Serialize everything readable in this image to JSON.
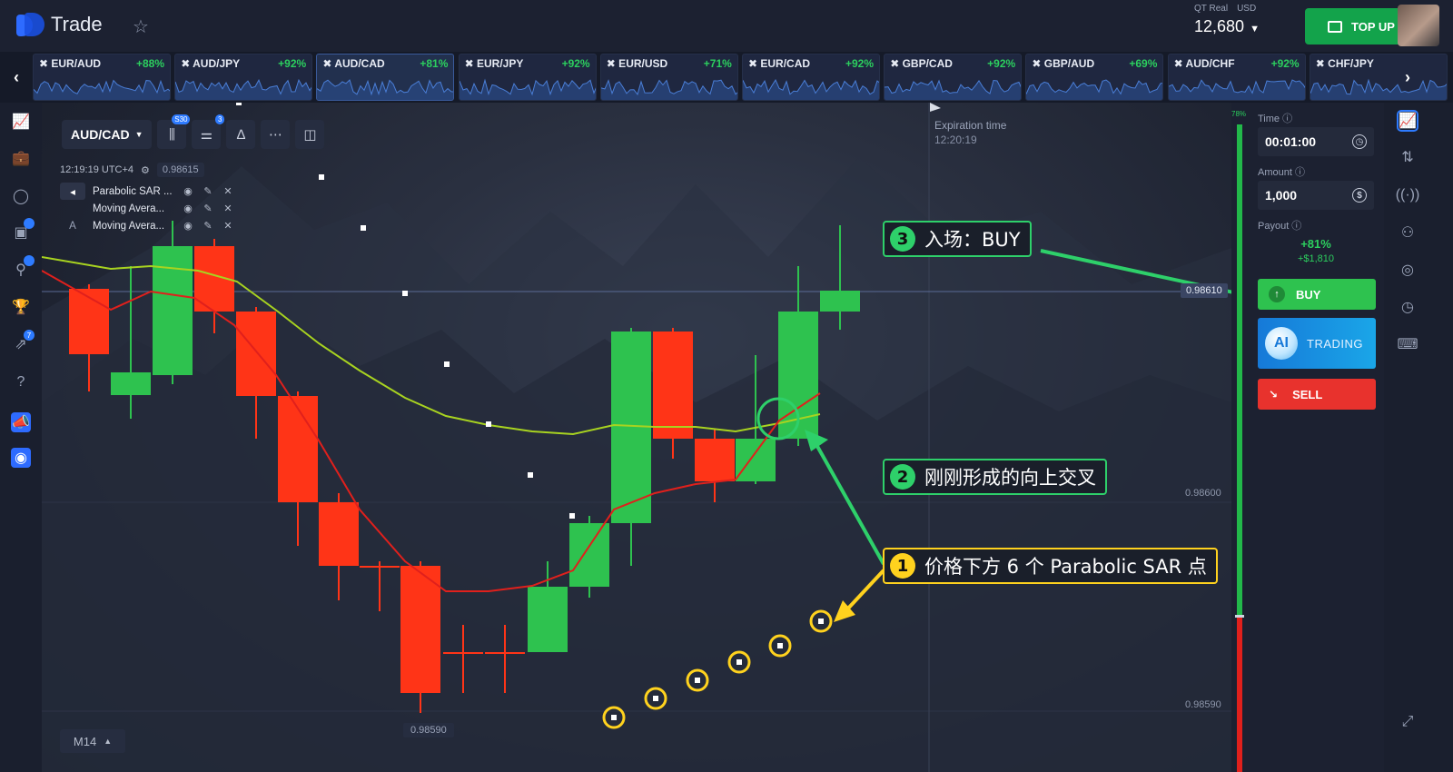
{
  "app": {
    "name": "Trade"
  },
  "account": {
    "type": "QT Real",
    "currency": "USD",
    "balance": "12,680"
  },
  "topup_label": "TOP UP",
  "assets": [
    {
      "name": "EUR/AUD",
      "pct": "+88%"
    },
    {
      "name": "AUD/JPY",
      "pct": "+92%"
    },
    {
      "name": "AUD/CAD",
      "pct": "+81%"
    },
    {
      "name": "EUR/JPY",
      "pct": "+92%"
    },
    {
      "name": "EUR/USD",
      "pct": "+71%"
    },
    {
      "name": "EUR/CAD",
      "pct": "+92%"
    },
    {
      "name": "GBP/CAD",
      "pct": "+92%"
    },
    {
      "name": "GBP/AUD",
      "pct": "+69%"
    },
    {
      "name": "AUD/CHF",
      "pct": "+92%"
    },
    {
      "name": "CHF/JPY",
      "pct": ""
    }
  ],
  "leftnav_badges": {
    "rocket": "",
    "share": "7"
  },
  "chart": {
    "pair": "AUD/CAD",
    "badge_candles": "S30",
    "badge_indicators": "3",
    "time": "12:19:19 UTC+4",
    "current_value": "0.98615",
    "indicators": [
      "Parabolic SAR ...",
      "Moving Avera...",
      "Moving Avera..."
    ],
    "expiration_label": "Expiration time",
    "expiration_time": "12:20:19",
    "price_tag": "0.98610",
    "y_labels": [
      "0.98600",
      "0.98590"
    ],
    "x_label": "0.98590",
    "timeframe": "M14"
  },
  "annotations": {
    "c1": {
      "num": "1",
      "text": "价格下方 6 个 Parabolic SAR 点"
    },
    "c2": {
      "num": "2",
      "text": "刚刚形成的向上交叉"
    },
    "c3": {
      "num": "3",
      "text": "入场：BUY"
    }
  },
  "trade_panel": {
    "meter_pct": "78%",
    "time_label": "Time",
    "time_value": "00:01:00",
    "amount_label": "Amount",
    "amount_value": "1,000",
    "payout_label": "Payout",
    "payout_pct": "+81%",
    "payout_amount": "+$1,810",
    "buy_label": "BUY",
    "ai_badge": "AI",
    "ai_label": "TRADING",
    "sell_label": "SELL"
  },
  "colors": {
    "bull": "#2ec24f",
    "bear": "#ff3417",
    "ma_fast": "#e0201c",
    "ma_slow": "#a8d320",
    "callout_green": "#2ed06a",
    "callout_yellow": "#ffd21e"
  }
}
